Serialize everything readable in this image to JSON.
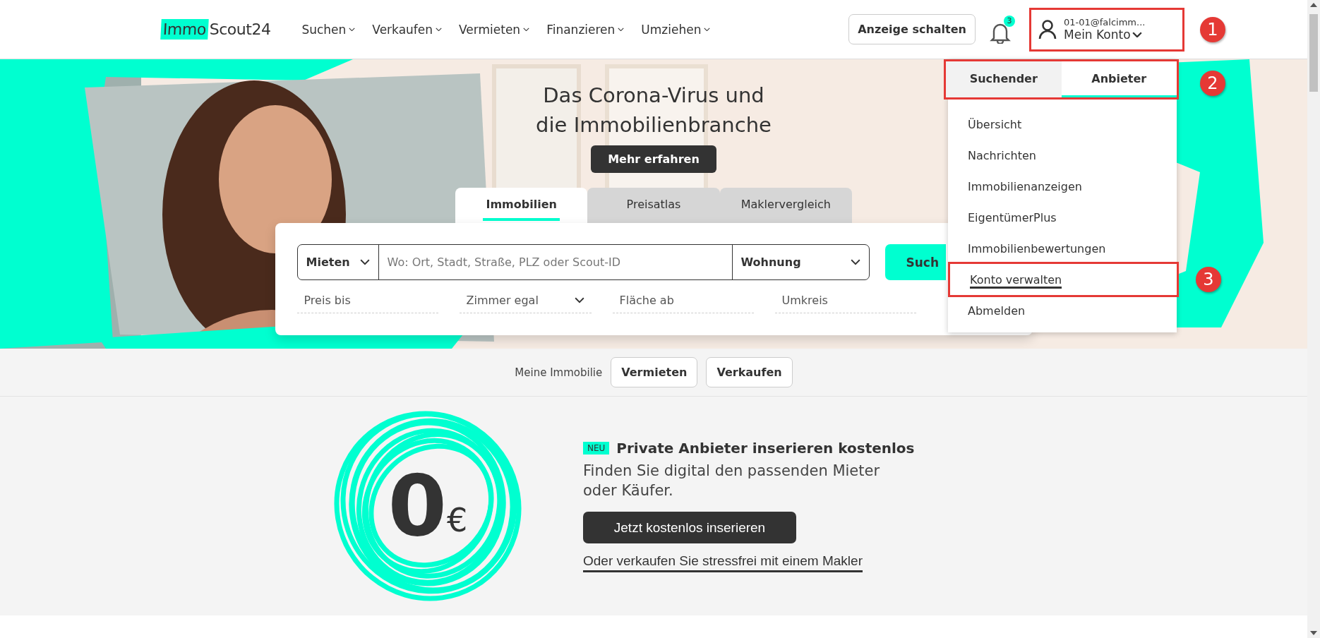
{
  "header": {
    "logo": {
      "part_1": "Immo",
      "part_2": "Scout24"
    },
    "nav": [
      {
        "label": "Suchen"
      },
      {
        "label": "Verkaufen"
      },
      {
        "label": "Vermieten"
      },
      {
        "label": "Finanzieren"
      },
      {
        "label": "Umziehen"
      }
    ],
    "post_ad_button": "Anzeige schalten",
    "notifications": {
      "count": "3"
    },
    "account": {
      "email": "01-01@falcimm...",
      "label": "Mein Konto"
    }
  },
  "hero": {
    "title_lines": [
      "Das Corona-Virus und",
      "die Immobilienbranche"
    ],
    "cta": "Mehr erfahren",
    "search_tabs": [
      {
        "label": "Immobilien",
        "selected": true
      },
      {
        "label": "Preisatlas",
        "selected": false
      },
      {
        "label": "Maklervergleich",
        "selected": false
      }
    ],
    "search": {
      "mode": "Mieten",
      "placeholder": "Wo: Ort, Stadt, Straße, PLZ oder Scout-ID",
      "type": "Wohnung",
      "button": "Such",
      "filters": [
        {
          "kind": "input",
          "placeholder": "Preis bis"
        },
        {
          "kind": "select",
          "value": "Zimmer egal"
        },
        {
          "kind": "input",
          "placeholder": "Fläche ab"
        },
        {
          "kind": "input",
          "placeholder": "Umkreis"
        }
      ]
    }
  },
  "account_menu": {
    "tabs": [
      {
        "label": "Suchender",
        "selected": false
      },
      {
        "label": "Anbieter",
        "selected": true
      }
    ],
    "items": [
      {
        "label": "Übersicht",
        "hovered": false
      },
      {
        "label": "Nachrichten",
        "hovered": false
      },
      {
        "label": "Immobilienanzeigen",
        "hovered": false
      },
      {
        "label": "EigentümerPlus",
        "hovered": false
      },
      {
        "label": "Immobilienbewertungen",
        "hovered": false
      },
      {
        "label": "Konto verwalten",
        "hovered": true
      },
      {
        "label": "Abmelden",
        "hovered": false
      }
    ]
  },
  "my_property": {
    "label": "Meine Immobilie",
    "buttons": [
      "Vermieten",
      "Verkaufen"
    ]
  },
  "promo": {
    "amount": "0",
    "currency": "€",
    "badge": "NEU",
    "title": "Private Anbieter inserieren kostenlos",
    "text": "Finden Sie digital den passenden Mieter oder Käufer.",
    "button": "Jetzt kostenlos inserieren",
    "link": "Oder verkaufen Sie stressfrei mit einem Makler"
  },
  "annotations": [
    {
      "number": "1"
    },
    {
      "number": "2"
    },
    {
      "number": "3"
    }
  ]
}
